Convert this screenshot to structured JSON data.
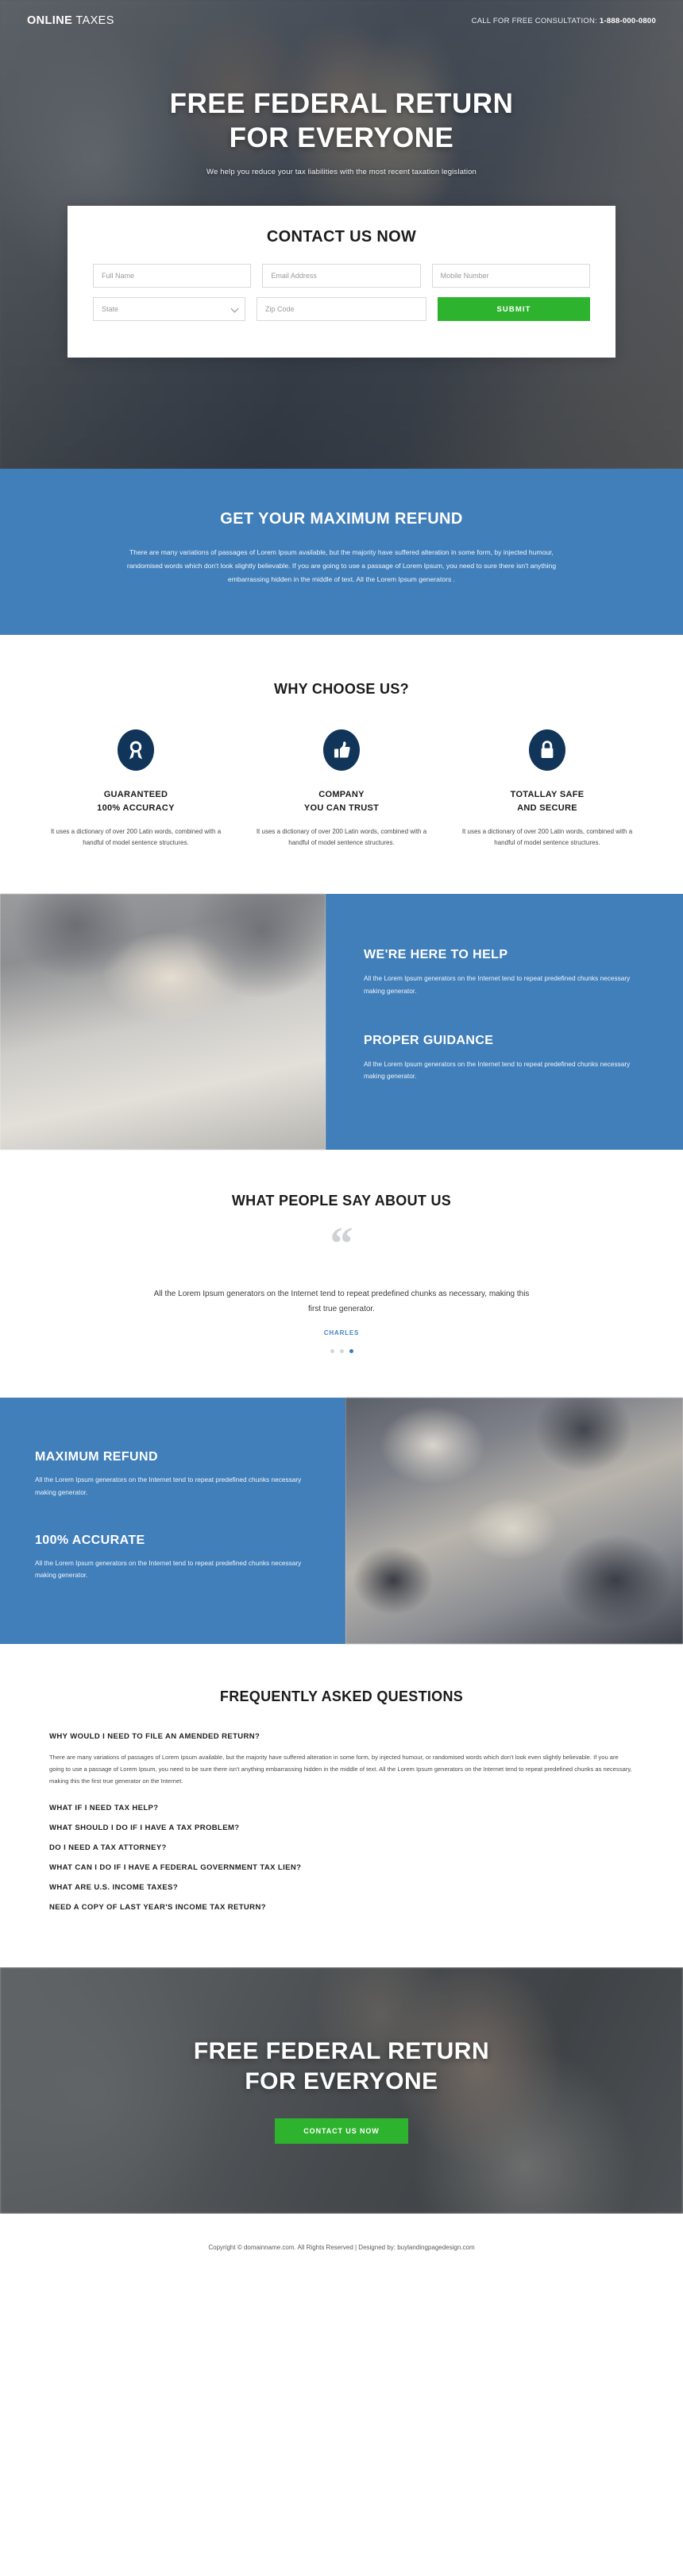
{
  "header": {
    "logo_bold": "ONLINE",
    "logo_light": " TAXES",
    "call_label": "CALL FOR FREE CONSULTATION: ",
    "phone": "1-888-000-0800"
  },
  "hero": {
    "headline_line1": "FREE FEDERAL RETURN",
    "headline_line2": "FOR EVERYONE",
    "subheadline": "We help you reduce your tax liabilities with the most recent taxation legislation"
  },
  "contact_form": {
    "title": "CONTACT US NOW",
    "full_name_placeholder": "Full Name",
    "email_placeholder": "Email Address",
    "mobile_placeholder": "Mobile Number",
    "state_selected": "State",
    "zip_placeholder": "Zip Code",
    "submit_label": "SUBMIT"
  },
  "refund": {
    "title": "GET YOUR MAXIMUM REFUND",
    "body": "There are many variations of passages of Lorem Ipsum available, but the majority have suffered alteration in some form, by injected humour, randomised words which don't look slightly believable. If you are going to use a passage of Lorem Ipsum, you need to sure there isn't anything embarrassing hidden in the middle of text. All the Lorem Ipsum generators ."
  },
  "why": {
    "title": "WHY CHOOSE US?",
    "items": [
      {
        "icon": "award-badge-icon",
        "title_line1": "GUARANTEED",
        "title_line2": "100% ACCURACY",
        "body": "It uses a dictionary of over 200 Latin words, combined with a handful of model sentence structures."
      },
      {
        "icon": "thumbs-up-icon",
        "title_line1": "COMPANY",
        "title_line2": "YOU CAN TRUST",
        "body": "It uses a dictionary of over 200 Latin words, combined with a handful of model sentence structures."
      },
      {
        "icon": "lock-icon",
        "title_line1": "TOTALLAY SAFE",
        "title_line2": "AND SECURE",
        "body": "It uses a dictionary of over 200 Latin words, combined with a handful of model sentence structures."
      }
    ]
  },
  "help_section": {
    "block1_title": "WE'RE HERE TO HELP",
    "block1_body": "All the Lorem Ipsum generators on the Internet tend to repeat predefined chunks necessary making generator.",
    "block2_title": "PROPER GUIDANCE",
    "block2_body": "All the Lorem Ipsum generators on the Internet tend to repeat predefined chunks necessary making generator."
  },
  "testimonial": {
    "title": "WHAT PEOPLE SAY ABOUT US",
    "quote_glyph": "“",
    "body": "All the Lorem Ipsum generators on the Internet tend to repeat predefined chunks as necessary, making this first true generator.",
    "author": "CHARLES",
    "dots_total": 3,
    "dot_active_index": 2
  },
  "refund_section": {
    "block1_title": "MAXIMUM REFUND",
    "block1_body": "All the Lorem Ipsum generators on the Internet tend to repeat predefined chunks necessary making generator.",
    "block2_title": "100% ACCURATE",
    "block2_body": "All the Lorem Ipsum generators on the Internet tend to repeat predefined chunks necessary making generator."
  },
  "faq": {
    "title": "FREQUENTLY ASKED QUESTIONS",
    "first_question": "WHY WOULD I NEED TO FILE AN AMENDED RETURN?",
    "first_answer": "There are many variations of passages of Lorem Ipsum available, but the majority have suffered alteration in some form, by injected humour, or randomised words which don't look even slightly believable. If you are going to use a passage of Lorem Ipsum, you need to be sure there isn't anything embarrassing hidden in the middle of text. All the Lorem Ipsum generators on the Internet tend to repeat predefined chunks as necessary, making this the first true generator on the Internet.",
    "questions": [
      "WHAT IF I NEED TAX HELP?",
      "WHAT SHOULD I DO IF I HAVE A TAX PROBLEM?",
      "DO I NEED A TAX ATTORNEY?",
      "WHAT CAN I DO IF I HAVE A FEDERAL GOVERNMENT TAX LIEN?",
      "WHAT ARE U.S. INCOME TAXES?",
      "NEED A COPY OF LAST YEAR'S INCOME TAX RETURN?"
    ]
  },
  "cta": {
    "headline_line1": "FREE FEDERAL RETURN",
    "headline_line2": "FOR EVERYONE",
    "button_label": "CONTACT US NOW"
  },
  "footer": {
    "copyright": "Copyright © domainname.com. All Rights Reserved | Designed by: buylandingpagedesign.com"
  },
  "colors": {
    "brand_blue": "#417fbb",
    "accent_green": "#2eb32e",
    "icon_navy": "#103559",
    "link_blue": "#4585c0"
  }
}
